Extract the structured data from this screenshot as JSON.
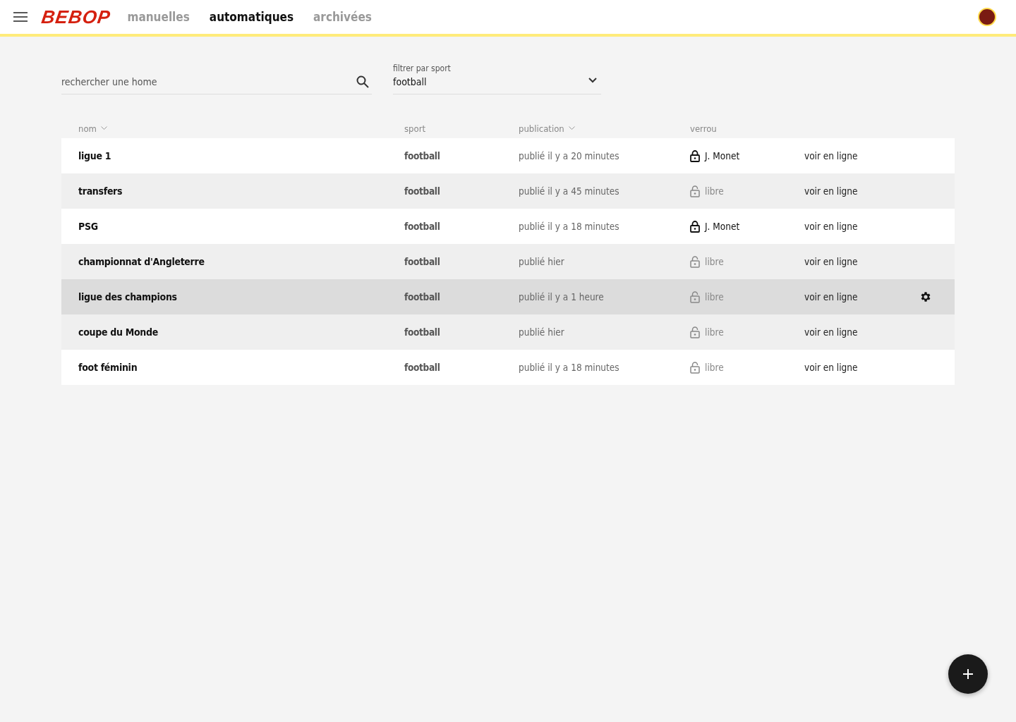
{
  "header": {
    "menu_icon": true,
    "logo": "BEBOP",
    "tabs": [
      {
        "label": "manuelles",
        "selected": false
      },
      {
        "label": "automatiques",
        "selected": true
      },
      {
        "label": "archivées",
        "selected": false
      }
    ]
  },
  "search": {
    "placeholder": "rechercher une home"
  },
  "filter": {
    "label": "filtrer par sport",
    "value": "football"
  },
  "table": {
    "columns": [
      {
        "label": "nom",
        "sortable": true
      },
      {
        "label": "sport",
        "sortable": false
      },
      {
        "label": "publication",
        "sortable": true
      },
      {
        "label": "verrou",
        "sortable": false
      }
    ],
    "rows": [
      {
        "name": "ligue 1",
        "sport": "football",
        "publication": "publié il y a 20 minutes",
        "lock": "J. Monet",
        "locked": true,
        "link": "voir en ligne",
        "hovered": false
      },
      {
        "name": "transfers",
        "sport": "football",
        "publication": "publié il y a 45 minutes",
        "lock": "libre",
        "locked": false,
        "link": "voir en ligne",
        "hovered": false
      },
      {
        "name": "PSG",
        "sport": "football",
        "publication": "publié il y a 18 minutes",
        "lock": "J. Monet",
        "locked": true,
        "link": "voir en ligne",
        "hovered": false
      },
      {
        "name": "championnat d'Angleterre",
        "sport": "football",
        "publication": "publié hier",
        "lock": "libre",
        "locked": false,
        "link": "voir en ligne",
        "hovered": false
      },
      {
        "name": "ligue des champions",
        "sport": "football",
        "publication": "publié il y a 1 heure",
        "lock": "libre",
        "locked": false,
        "link": "voir en ligne",
        "hovered": true
      },
      {
        "name": "coupe du Monde",
        "sport": "football",
        "publication": "publié hier",
        "lock": "libre",
        "locked": false,
        "link": "voir en ligne",
        "hovered": false
      },
      {
        "name": "foot féminin",
        "sport": "football",
        "publication": "publié il y a 18 minutes",
        "lock": "libre",
        "locked": false,
        "link": "voir en ligne",
        "hovered": false
      }
    ]
  }
}
